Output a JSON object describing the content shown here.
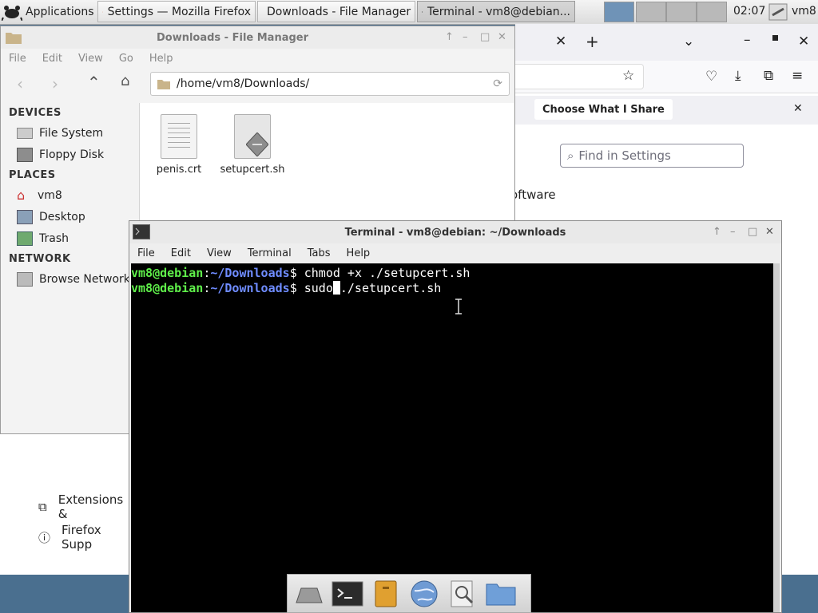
{
  "panel": {
    "applications_label": "Applications",
    "tasks": [
      {
        "label": "Settings — Mozilla Firefox"
      },
      {
        "label": "Downloads - File Manager"
      },
      {
        "label": "Terminal - vm8@debian..."
      }
    ],
    "clock": "02:07",
    "user": "vm8"
  },
  "firefox": {
    "notice_button": "Choose What I Share",
    "search_placeholder": "Find in Settings",
    "partial_text": "oftware",
    "links": [
      {
        "label": "Extensions &"
      },
      {
        "label": "Firefox Supp"
      }
    ]
  },
  "file_manager": {
    "title": "Downloads - File Manager",
    "menu": [
      "File",
      "Edit",
      "View",
      "Go",
      "Help"
    ],
    "path": "/home/vm8/Downloads/",
    "sections": {
      "devices": "DEVICES",
      "places": "PLACES",
      "network": "NETWORK"
    },
    "devices": [
      "File System",
      "Floppy Disk"
    ],
    "places": [
      "vm8",
      "Desktop",
      "Trash"
    ],
    "network": [
      "Browse Network"
    ],
    "files": [
      {
        "name": "penis.crt",
        "icon": "certificate-file-icon"
      },
      {
        "name": "setupcert.sh",
        "icon": "shell-script-icon"
      }
    ]
  },
  "terminal": {
    "title": "Terminal - vm8@debian: ~/Downloads",
    "menu": [
      "File",
      "Edit",
      "View",
      "Terminal",
      "Tabs",
      "Help"
    ],
    "prompt_user": "vm8@debian",
    "prompt_dir": "~/Downloads",
    "prompt_sym": "$",
    "lines": [
      {
        "cmd_before": "chmod +x ./setupcert.sh",
        "cmd_after": ""
      },
      {
        "cmd_before": "sudo",
        "cmd_after": "./setupcert.sh"
      }
    ]
  },
  "dock": {
    "items": [
      "show-desktop-icon",
      "terminal-icon",
      "file-manager-icon",
      "web-browser-icon",
      "app-finder-icon",
      "folder-icon"
    ]
  }
}
